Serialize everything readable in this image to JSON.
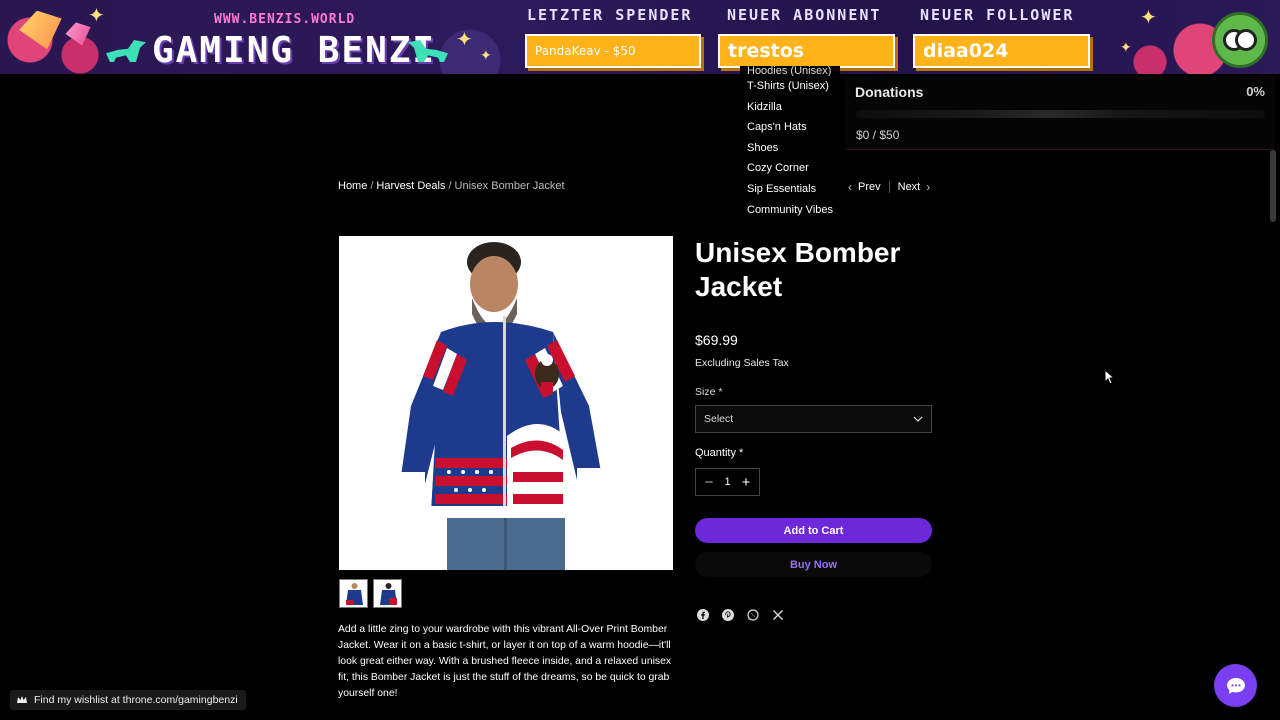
{
  "overlay": {
    "site_url": "WWW.BENZIS.WORLD",
    "logo_text": "GAMING BENZI",
    "stats": [
      {
        "label": "LETZTER SPENDER",
        "value": "PandaKeav - $50"
      },
      {
        "label": "NEUER ABONNENT",
        "value": "trestos"
      },
      {
        "label": "NEUER FOLLOWER",
        "value": "diaa024"
      }
    ]
  },
  "category_menu": {
    "items": [
      "Hoodies (Unisex)",
      "T-Shirts (Unisex)",
      "Kidzilla",
      "Caps'n Hats",
      "Shoes",
      "Cozy Corner",
      "Sip Essentials",
      "Community Vibes"
    ]
  },
  "donations": {
    "title": "Donations",
    "percent_label": "0%",
    "progress_fraction": 0,
    "amount_label": "$0 / $50",
    "bar_color": "#e74c3c"
  },
  "breadcrumb": {
    "home": "Home",
    "category": "Harvest Deals",
    "current": "Unisex Bomber Jacket",
    "separator": "/"
  },
  "pager": {
    "prev": "Prev",
    "next": "Next"
  },
  "product": {
    "title": "Unisex Bomber Jacket",
    "price": "$69.99",
    "tax_note": "Excluding Sales Tax",
    "size_label": "Size *",
    "size_value": "Select",
    "quantity_label": "Quantity *",
    "quantity": "1",
    "add_to_cart": "Add to Cart",
    "buy_now": "Buy Now",
    "description": "Add a little zing to your wardrobe with this vibrant All-Over Print Bomber Jacket. Wear it on a basic t-shirt, or layer it on top of a warm hoodie—it'll look great either way. With a brushed fleece inside, and a relaxed unisex fit, this Bomber Jacket is just the stuff of the dreams, so be quick to grab yourself one!",
    "share_icons": [
      "facebook-icon",
      "pinterest-icon",
      "whatsapp-icon",
      "x-icon"
    ]
  },
  "wishlist": {
    "text": "Find my wishlist at throne.com/gamingbenzi"
  },
  "colors": {
    "accent": "#6d28d9",
    "buy_now_text": "#9a6ef0",
    "banner_orange": "#ffb21a",
    "chat_button": "#7a3ff0"
  }
}
